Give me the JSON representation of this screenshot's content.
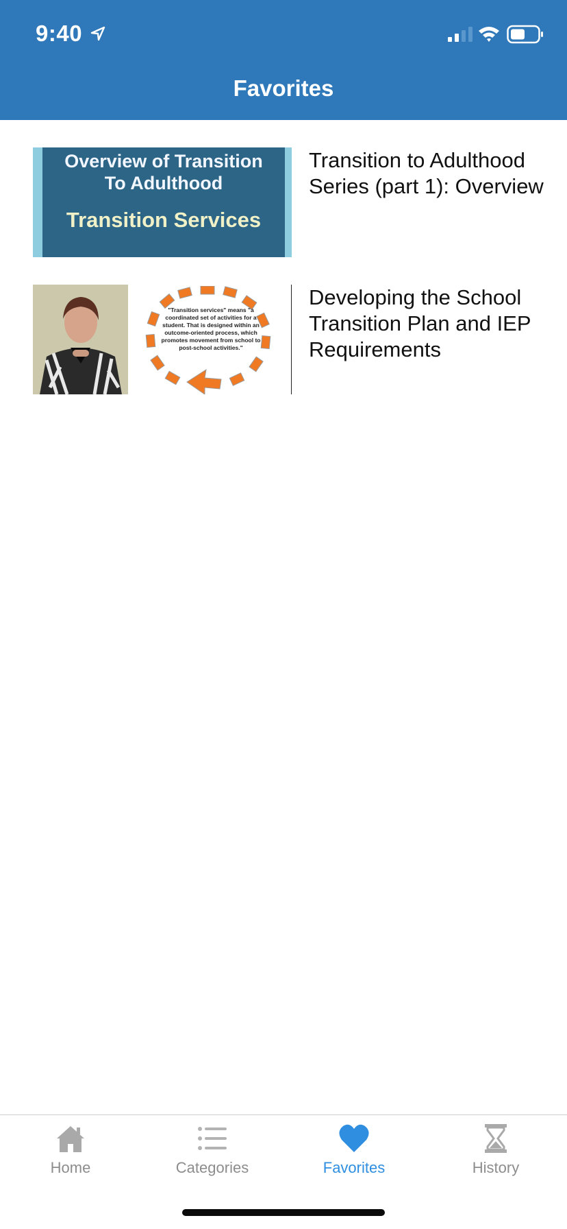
{
  "status_bar": {
    "time": "9:40"
  },
  "header": {
    "title": "Favorites"
  },
  "favorites": [
    {
      "title": "Transition to Adulthood Series (part 1): Overview",
      "thumbnail": {
        "line1": "Overview of Transition",
        "line2": "To Adulthood",
        "line3": "Transition Services"
      }
    },
    {
      "title": "Developing the School Transition Plan and IEP Requirements",
      "thumbnail": {
        "quote": "\"Transition services\" means \"a coordinated set of activities for a student. That is designed within an outcome-oriented process, which promotes movement from school to post-school activities.\""
      }
    }
  ],
  "tabbar": {
    "tabs": [
      {
        "label": "Home",
        "icon": "house-icon"
      },
      {
        "label": "Categories",
        "icon": "list-icon"
      },
      {
        "label": "Favorites",
        "icon": "heart-icon",
        "active": true
      },
      {
        "label": "History",
        "icon": "hourglass-icon"
      }
    ]
  },
  "colors": {
    "header_bg": "#2f78b9",
    "active_tab": "#2f8ee0",
    "inactive_tab": "#8d8d8d"
  }
}
